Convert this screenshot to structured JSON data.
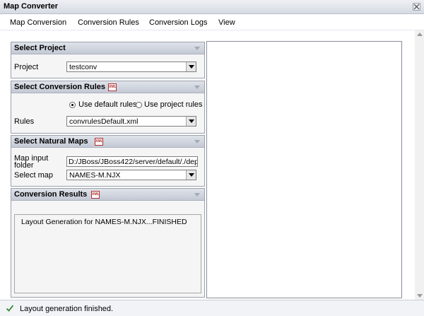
{
  "window": {
    "title": "Map Converter"
  },
  "menu": {
    "items": [
      "Map Conversion",
      "Conversion Rules",
      "Conversion Logs",
      "View"
    ]
  },
  "select_project": {
    "title": "Select Project",
    "project_label": "Project",
    "project_value": "testconv"
  },
  "conversion_rules": {
    "title": "Select Conversion Rules",
    "radio_default": "Use default rules",
    "radio_project": "Use project rules",
    "rules_label": "Rules",
    "rules_value": "convrulesDefault.xml"
  },
  "natural_maps": {
    "title": "Select Natural Maps",
    "input_folder_label_1": "Map input",
    "input_folder_label_2": "folder",
    "input_folder_value": "D:/JBoss/JBoss422/server/default/./dep",
    "select_map_label": "Select map",
    "select_map_value": "NAMES-M.NJX"
  },
  "conversion_results": {
    "title": "Conversion Results",
    "text": "Layout Generation for NAMES-M.NJX...FINISHED"
  },
  "status": {
    "message": "Layout generation finished."
  },
  "icons": {
    "close": "close-icon",
    "collapse": "collapse-arrow-icon",
    "xml": "xml-file-icon",
    "check": "checkmark-icon"
  },
  "colors": {
    "check_green": "#2e8b2e",
    "panel_header": "#c3c9d4"
  }
}
